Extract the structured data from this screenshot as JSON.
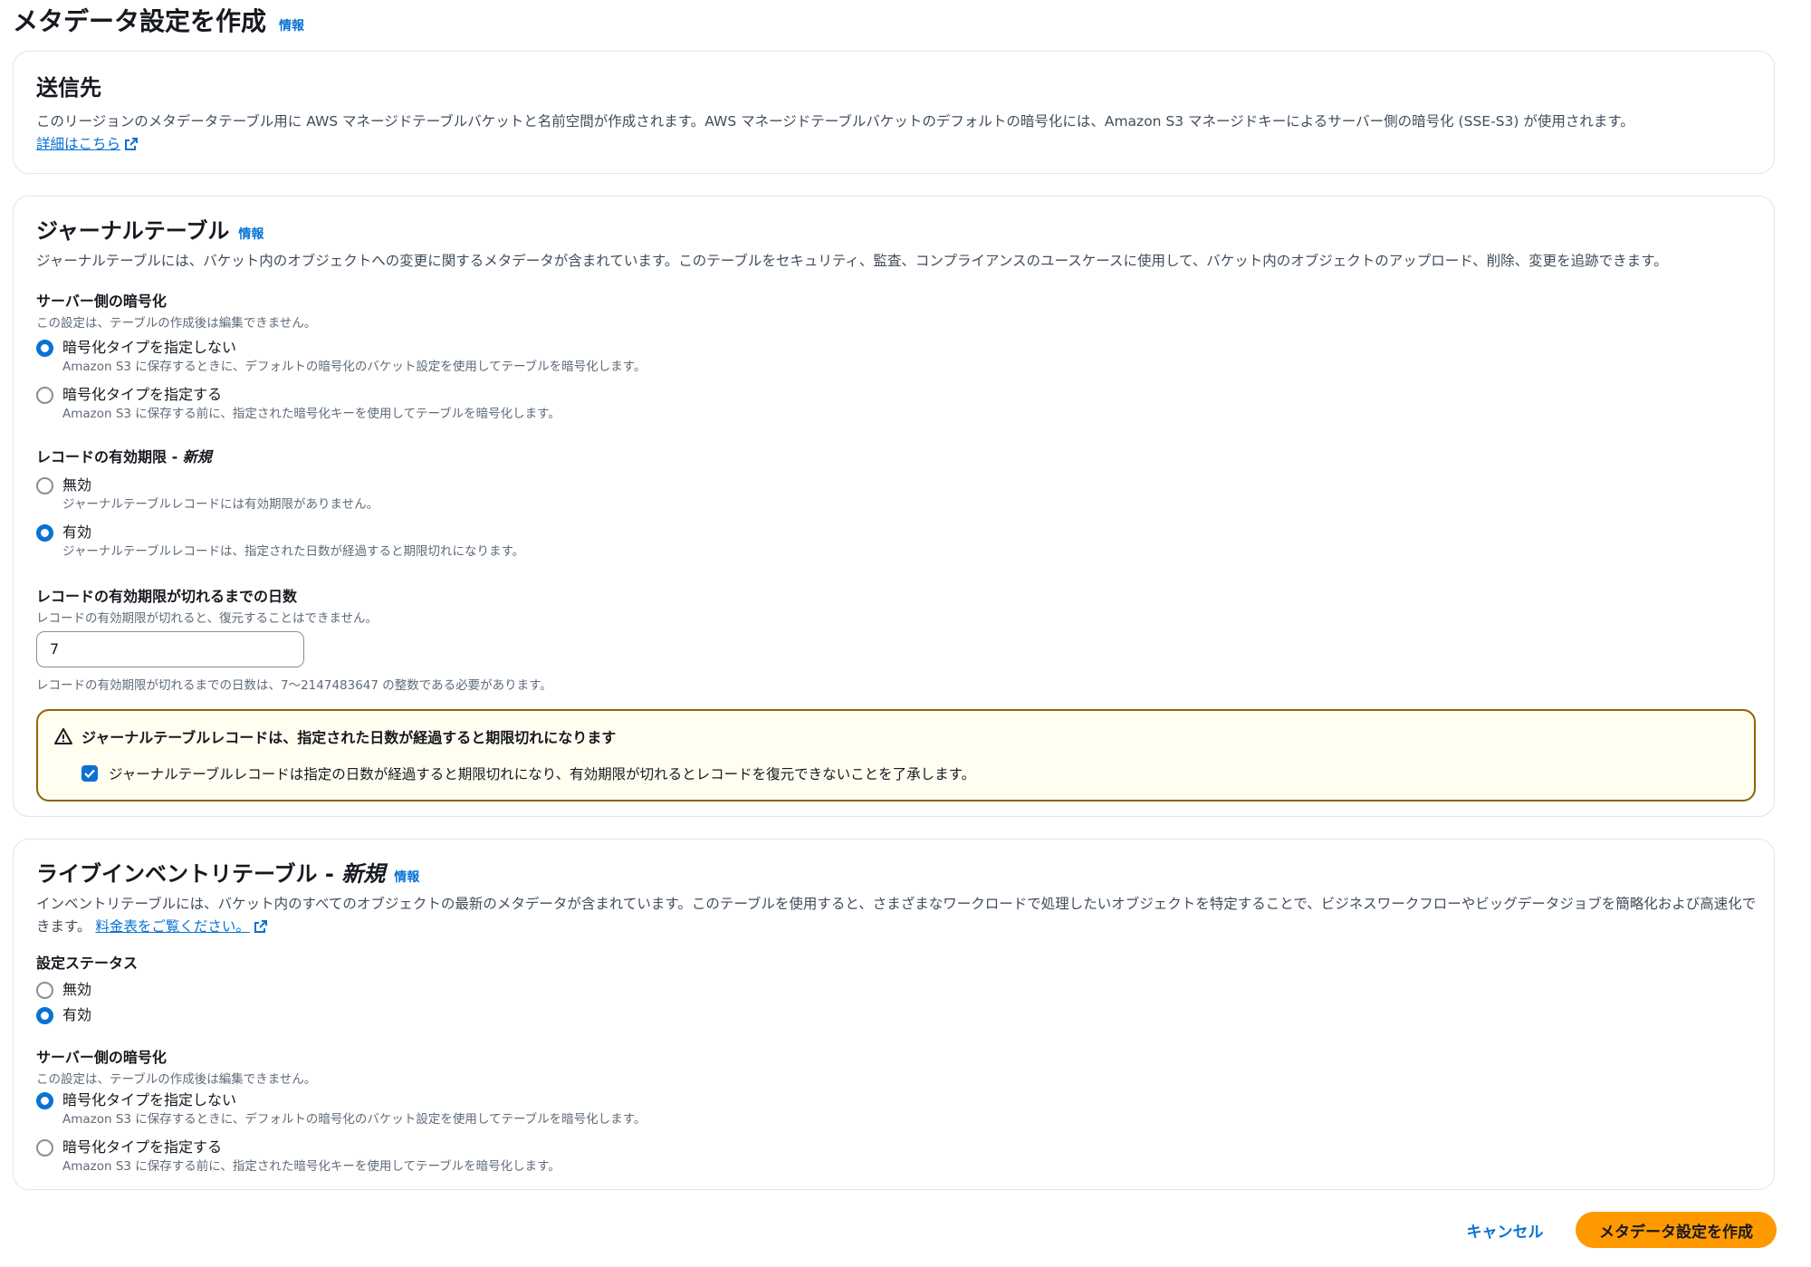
{
  "page": {
    "title": "メタデータ設定を作成",
    "info": "情報"
  },
  "destination": {
    "title": "送信先",
    "description": "このリージョンのメタデータテーブル用に AWS マネージドテーブルバケットと名前空間が作成されます。AWS マネージドテーブルバケットのデフォルトの暗号化には、Amazon S3 マネージドキーによるサーバー側の暗号化 (SSE-S3) が使用されます。",
    "learn_more": "詳細はこちら"
  },
  "journal": {
    "title": "ジャーナルテーブル",
    "info": "情報",
    "description": "ジャーナルテーブルには、バケット内のオブジェクトへの変更に関するメタデータが含まれています。このテーブルをセキュリティ、監査、コンプライアンスのユースケースに使用して、バケット内のオブジェクトのアップロード、削除、変更を追跡できます。",
    "encryption": {
      "label": "サーバー側の暗号化",
      "description": "この設定は、テーブルの作成後は編集できません。",
      "options": [
        {
          "label": "暗号化タイプを指定しない",
          "description": "Amazon S3 に保存するときに、デフォルトの暗号化のバケット設定を使用してテーブルを暗号化します。",
          "selected": true
        },
        {
          "label": "暗号化タイプを指定する",
          "description": "Amazon S3 に保存する前に、指定された暗号化キーを使用してテーブルを暗号化します。",
          "selected": false
        }
      ]
    },
    "expiration": {
      "label": "レコードの有効期限 - ",
      "label_new": "新規",
      "options": [
        {
          "label": "無効",
          "description": "ジャーナルテーブルレコードには有効期限がありません。",
          "selected": false
        },
        {
          "label": "有効",
          "description": "ジャーナルテーブルレコードは、指定された日数が経過すると期限切れになります。",
          "selected": true
        }
      ]
    },
    "days": {
      "label": "レコードの有効期限が切れるまでの日数",
      "description": "レコードの有効期限が切れると、復元することはできません。",
      "value": "7",
      "constraint": "レコードの有効期限が切れるまでの日数は、7〜2147483647 の整数である必要があります。"
    },
    "alert": {
      "title": "ジャーナルテーブルレコードは、指定された日数が経過すると期限切れになります",
      "ack": "ジャーナルテーブルレコードは指定の日数が経過すると期限切れになり、有効期限が切れるとレコードを復元できないことを了承します。",
      "checked": true
    }
  },
  "inventory": {
    "title": "ライブインベントリテーブル - ",
    "title_new": "新規",
    "info": "情報",
    "description": "インベントリテーブルには、バケット内のすべてのオブジェクトの最新のメタデータが含まれています。このテーブルを使用すると、さまざまなワークロードで処理したいオブジェクトを特定することで、ビジネスワークフローやビッグデータジョブを簡略化および高速化できます。",
    "pricing_link": "料金表をご覧ください。",
    "status": {
      "label": "設定ステータス",
      "options": [
        {
          "label": "無効",
          "selected": false
        },
        {
          "label": "有効",
          "selected": true
        }
      ]
    },
    "encryption": {
      "label": "サーバー側の暗号化",
      "description": "この設定は、テーブルの作成後は編集できません。",
      "options": [
        {
          "label": "暗号化タイプを指定しない",
          "description": "Amazon S3 に保存するときに、デフォルトの暗号化のバケット設定を使用してテーブルを暗号化します。",
          "selected": true
        },
        {
          "label": "暗号化タイプを指定する",
          "description": "Amazon S3 に保存する前に、指定された暗号化キーを使用してテーブルを暗号化します。",
          "selected": false
        }
      ]
    }
  },
  "footer": {
    "cancel": "キャンセル",
    "submit": "メタデータ設定を作成"
  },
  "colors": {
    "link": "#0972d3",
    "primary_button": "#ff9900",
    "warning_border": "#8d6605",
    "warning_bg": "#fffef0"
  }
}
